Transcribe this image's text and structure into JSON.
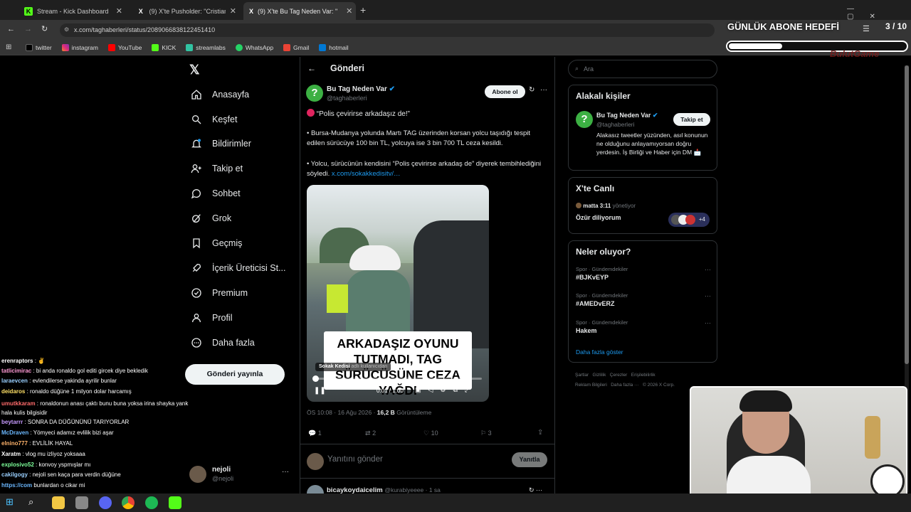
{
  "browser": {
    "tabs": [
      {
        "title": "Stream - Kick Dashboard",
        "icon": "K"
      },
      {
        "title": "(9) X'te Pusholder: \"Cristiano R",
        "icon": "X"
      },
      {
        "title": "(9) X'te Bu Tag Neden Var: \"",
        "icon": "X"
      }
    ],
    "url": "x.com/taghaberleri/status/2089066838122451410",
    "bookmarks": [
      "twitter",
      "instagram",
      "YouTube",
      "KICK",
      "streamlabs",
      "WhatsApp",
      "Gmail",
      "hotmail"
    ]
  },
  "overlay": {
    "title": "GÜNLÜK ABONE HEDEFİ",
    "count": "3 / 10",
    "progress": 0.3,
    "brand": "BulutGame"
  },
  "nav": {
    "items": [
      "Anasayfa",
      "Keşfet",
      "Bildirimler",
      "Takip et",
      "Sohbet",
      "Grok",
      "Geçmiş",
      "İçerik Üreticisi St...",
      "Premium",
      "Profil",
      "Daha fazla"
    ],
    "post_button": "Gönderi yayınla",
    "user_name": "nejoli",
    "user_handle": "@nejoli"
  },
  "post": {
    "header": "Gönderi",
    "author": "Bu Tag Neden Var",
    "handle": "@taghaberleri",
    "subscribe": "Abone ol",
    "headline": "“Polis çevirirse arkadaşız de!”",
    "para1": "• Bursa-Mudanya yolunda Martı TAG üzerinden korsan yolcu taşıdığı tespit edilen sürücüye 100 bin TL, yolcuya ise 3 bin 700 TL ceza kesildi.",
    "para2": "• Yolcu, sürücünün kendisini “Polis çevirirse arkadaş de” diyerek tembihlediğini söyledi.",
    "para2_link": "x.com/sokakkedisitv/…",
    "video_caption": "ARKADAŞIZ OYUNU TUTMADI, TAG SÜRÜCÜSÜNE CEZA YAĞDI",
    "video_credit_name": "Sokak Kedisi",
    "video_credit_suffix": "adlı kullanıcıdan",
    "video_time": "0:01 / 1:00",
    "video_progress": 0.017,
    "timestamp": "ÖS 10:08 · 16 Ağu 2026 ·",
    "views": "16,2 B",
    "views_label": "Görüntüleme",
    "replies": "1",
    "reposts": "2",
    "likes": "10",
    "bookmarks": "3",
    "reply_placeholder": "Yanıtını gönder",
    "reply_button": "Yanıtla",
    "next_author": "bicaykoydaicelim",
    "next_handle": "@kurabiyeeee · 1 sa"
  },
  "right": {
    "search_placeholder": "Ara",
    "related_title": "Alakalı kişiler",
    "related_name": "Bu Tag Neden Var",
    "related_handle": "@taghaberleri",
    "follow": "Takip et",
    "related_bio": "Alakasız tweetler yüzünden, asıl konunun ne olduğunu anlayamıyorsan doğru yerdesin. İş Birliği ve Haber için DM 📩",
    "live_title": "X'te Canlı",
    "live_host": "matta 3:11",
    "live_role": "yönetiyor",
    "live_topic": "Özür diliyorum",
    "live_extra": "+4",
    "trends_title": "Neler oluyor?",
    "trends": [
      {
        "category": "Spor · Gündemdekiler",
        "name": "#BJKvEYP"
      },
      {
        "category": "Spor · Gündemdekiler",
        "name": "#AMEDvERZ"
      },
      {
        "category": "Spor · Gündemdekiler",
        "name": "Hakem"
      }
    ],
    "show_more": "Daha fazla göster",
    "footer_line1": "Şartlar   Gizlilik   Çerezler   Erişilebilirlik",
    "footer_line2": "Reklam Bilgileri   Daha fazla ···   © 2026 X Corp."
  },
  "chat": [
    {
      "user": "erenraptors",
      "text": ": ✌️",
      "color": "#ffffff"
    },
    {
      "user": "tatlicimirac",
      "text": ": bi anda ronaldo gol editi gircek diye bekledik",
      "color": "#ff9ad5"
    },
    {
      "user": "laraevcen",
      "text": ": evlendilerse yakinda ayrilir bunlar",
      "color": "#9ad0ff"
    },
    {
      "user": "deidaros",
      "text": ": ronaldo düğüne 1 milyon dolar harcamış",
      "color": "#ffe066"
    },
    {
      "user": "umutkkaram",
      "text": ": ronaldonun anası çaktı bunu buna yoksa irina shayka yank hala kulis bilgisidir",
      "color": "#ff6b6b"
    },
    {
      "user": "beytarrr",
      "text": ": SONRA DA DÜĞÜNÜNÜ TARIYORLAR",
      "color": "#c89bff"
    },
    {
      "user": "McDraven",
      "text": ": Yömyeci adamız evlilik bizi aşar",
      "color": "#6bb8ff"
    },
    {
      "user": "elnino777",
      "text": ": EVLİLİK HAYAL",
      "color": "#ffb36b"
    },
    {
      "user": "Xaratm",
      "text": ": vlog mu izliyoz yoksaaa",
      "color": "#ffffff"
    },
    {
      "user": "explosivo52",
      "text": ": konvoy yspmışlar mı",
      "color": "#7dff9a"
    },
    {
      "user": "cakilgogy",
      "text": ": nejoli sen kaça para verdin düğüne",
      "color": "#9ad0ff"
    },
    {
      "user": "https://com",
      "text": "bunlardan o cikar mi",
      "color": "#6bb8ff"
    }
  ]
}
